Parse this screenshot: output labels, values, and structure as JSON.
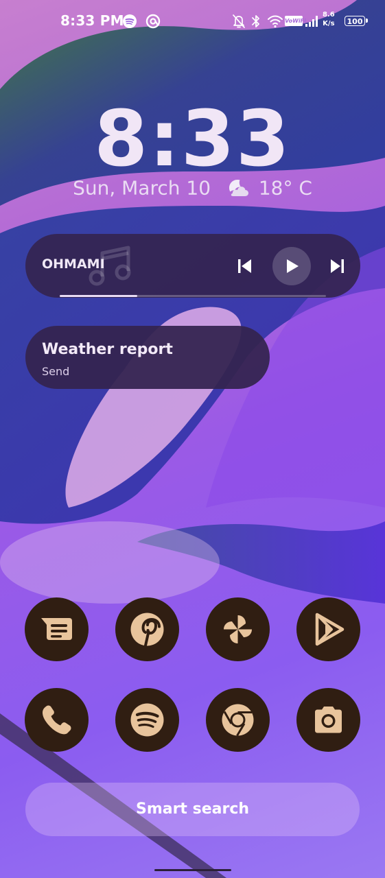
{
  "status_bar": {
    "time": "8:33 PM",
    "speed_value": "8.6",
    "speed_unit": "K/s",
    "battery": "100",
    "volte": "VoWiFi",
    "icons": [
      "spotify-icon",
      "at-sign-icon",
      "bell-off-icon",
      "bluetooth-icon",
      "wifi-icon",
      "signal-icon"
    ]
  },
  "lockscreen": {
    "clock": "8:33",
    "date": "Sun, March 10",
    "temperature": "18° C",
    "weather_icon": "moon-cloud-icon"
  },
  "media": {
    "title": "OHMAMI",
    "progress_fraction": 0.29,
    "controls": [
      "previous-icon",
      "play-icon",
      "next-icon"
    ]
  },
  "notification": {
    "title": "Weather report",
    "subtitle": "Send"
  },
  "apps": [
    {
      "name": "messages-app",
      "icon": "chat-icon"
    },
    {
      "name": "pinterest-app",
      "icon": "pinterest-icon"
    },
    {
      "name": "pinwheel-app",
      "icon": "pinwheel-icon"
    },
    {
      "name": "play-store-app",
      "icon": "play-store-icon"
    },
    {
      "name": "phone-app",
      "icon": "phone-icon"
    },
    {
      "name": "spotify-app",
      "icon": "spotify-icon"
    },
    {
      "name": "chrome-app",
      "icon": "chrome-icon"
    },
    {
      "name": "camera-app",
      "icon": "camera-icon"
    }
  ],
  "search": {
    "label": "Smart search"
  },
  "colors": {
    "card_bg": "#342450",
    "app_icon_bg": "#301e12",
    "app_glyph": "#e8c49c"
  }
}
